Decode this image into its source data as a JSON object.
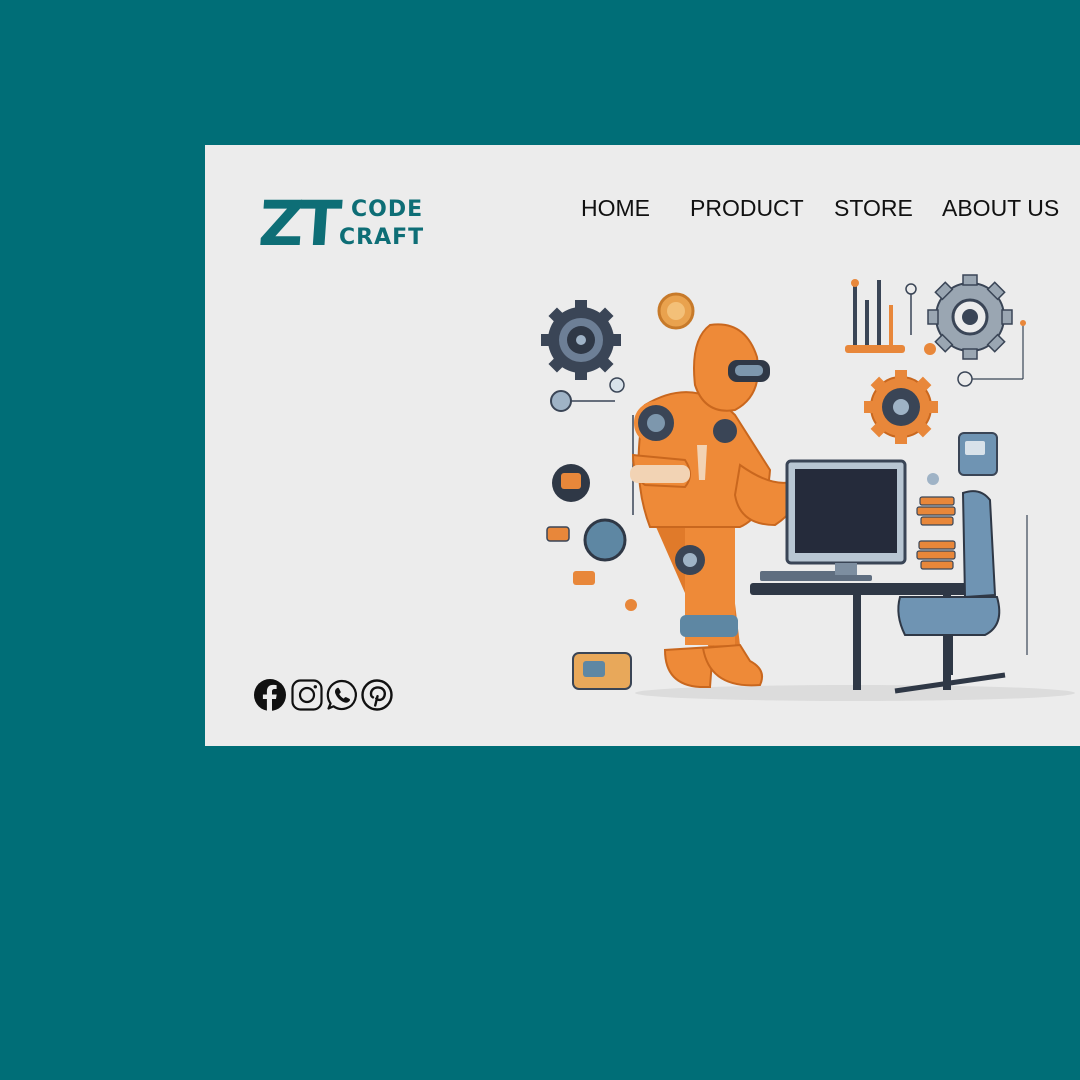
{
  "brand": {
    "logo_mark": "ZT",
    "logo_line1": "CODE",
    "logo_line2": "CRAFT",
    "color": "#0e6e76"
  },
  "nav": {
    "items": [
      {
        "label": "HOME"
      },
      {
        "label": "PRODUCT"
      },
      {
        "label": "STORE"
      },
      {
        "label": "ABOUT US"
      }
    ]
  },
  "social": {
    "icons": [
      "facebook-icon",
      "instagram-icon",
      "whatsapp-icon",
      "pinterest-icon"
    ]
  },
  "hero": {
    "illustration": "robot-at-computer-illustration"
  },
  "colors": {
    "background": "#006e77",
    "panel": "#ececec",
    "accent_orange": "#e8873a",
    "accent_blue": "#5e87a3"
  }
}
